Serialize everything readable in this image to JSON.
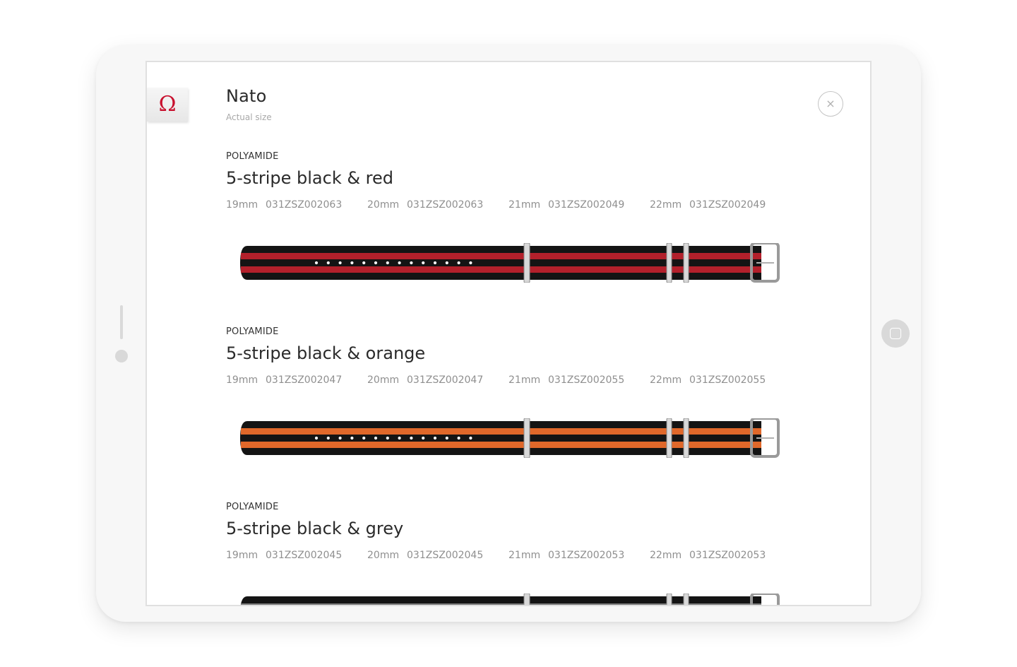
{
  "app": {
    "logo_symbol": "Ω",
    "title": "Nato",
    "subtitle": "Actual size",
    "close_icon": "×",
    "brand_color": "#c8102e"
  },
  "products": [
    {
      "material": "POLYAMIDE",
      "name": "5-stripe black & red",
      "stripe_color": "#b3202b",
      "sizes": [
        {
          "size": "19mm",
          "ref": "031ZSZ002063"
        },
        {
          "size": "20mm",
          "ref": "031ZSZ002063"
        },
        {
          "size": "21mm",
          "ref": "031ZSZ002049"
        },
        {
          "size": "22mm",
          "ref": "031ZSZ002049"
        }
      ]
    },
    {
      "material": "POLYAMIDE",
      "name": "5-stripe black & orange",
      "stripe_color": "#e0682a",
      "sizes": [
        {
          "size": "19mm",
          "ref": "031ZSZ002047"
        },
        {
          "size": "20mm",
          "ref": "031ZSZ002047"
        },
        {
          "size": "21mm",
          "ref": "031ZSZ002055"
        },
        {
          "size": "22mm",
          "ref": "031ZSZ002055"
        }
      ]
    },
    {
      "material": "POLYAMIDE",
      "name": "5-stripe black & grey",
      "stripe_color": "#7a7a7a",
      "sizes": [
        {
          "size": "19mm",
          "ref": "031ZSZ002045"
        },
        {
          "size": "20mm",
          "ref": "031ZSZ002045"
        },
        {
          "size": "21mm",
          "ref": "031ZSZ002053"
        },
        {
          "size": "22mm",
          "ref": "031ZSZ002053"
        }
      ]
    }
  ]
}
